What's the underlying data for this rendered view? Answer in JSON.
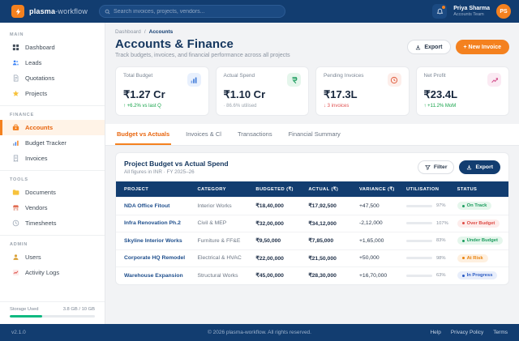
{
  "topbar": {
    "brand_bold": "plasma",
    "brand_light": "-workflow",
    "search_placeholder": "Search invoices, projects, vendors...",
    "user_name": "Priya Sharma",
    "user_role": "Accounts Team",
    "avatar_initials": "PS"
  },
  "sidebar": {
    "sections": [
      {
        "title": "MAIN",
        "items": [
          {
            "label": "Dashboard",
            "icon": "dashboard",
            "active": false
          },
          {
            "label": "Leads",
            "icon": "leads",
            "active": false
          },
          {
            "label": "Quotations",
            "icon": "quotations",
            "active": false
          },
          {
            "label": "Projects",
            "icon": "projects",
            "active": false
          }
        ]
      },
      {
        "title": "FINANCE",
        "items": [
          {
            "label": "Accounts",
            "icon": "accounts",
            "active": true
          },
          {
            "label": "Budget Tracker",
            "icon": "budget-tracker",
            "active": false
          },
          {
            "label": "Invoices",
            "icon": "invoices",
            "active": false
          }
        ]
      },
      {
        "title": "TOOLS",
        "items": [
          {
            "label": "Documents",
            "icon": "documents",
            "active": false
          },
          {
            "label": "Vendors",
            "icon": "vendors",
            "active": false
          },
          {
            "label": "Timesheets",
            "icon": "timesheets",
            "active": false
          }
        ]
      },
      {
        "title": "ADMIN",
        "items": [
          {
            "label": "Users",
            "icon": "users",
            "active": false
          },
          {
            "label": "Activity Logs",
            "icon": "activity-logs",
            "active": false
          }
        ]
      }
    ],
    "storage_label": "Storage Used",
    "storage_value": "3.8 GB / 10 GB",
    "storage_pct": 38
  },
  "breadcrumb": {
    "parent": "Dashboard",
    "separator": "/",
    "current": "Accounts"
  },
  "page": {
    "title": "Accounts & Finance",
    "subtitle": "Track budgets, invoices, and financial performance across all projects",
    "export_label": "Export",
    "new_invoice_label": "+ New Invoice"
  },
  "stats": [
    {
      "label": "Total Budget",
      "value": "₹1.27 Cr",
      "delta": "↑ +6.2% vs last Q",
      "delta_color": "green",
      "icon": "bar-chart",
      "icon_bg": "#e8f0fd",
      "icon_color": "#3b77d8"
    },
    {
      "label": "Actual Spend",
      "value": "₹1.10 Cr",
      "delta": "· 86.6% utilised",
      "delta_color": "gray",
      "icon": "currency",
      "icon_bg": "#e5f6ec",
      "icon_color": "#1d9d5f"
    },
    {
      "label": "Pending Invoices",
      "value": "₹17.3L",
      "delta": "↓ 3 invoices",
      "delta_color": "red",
      "icon": "clock",
      "icon_bg": "#fdeeea",
      "icon_color": "#e05a3a"
    },
    {
      "label": "Net Profit",
      "value": "₹23.4L",
      "delta": "↑ +11.2% MoM",
      "delta_color": "green",
      "icon": "trend-up",
      "icon_bg": "#fbeaf3",
      "icon_color": "#d4548f"
    }
  ],
  "tabs": [
    {
      "label": "Budget vs Actuals",
      "active": true
    },
    {
      "label": "Invoices & Cl",
      "active": false
    },
    {
      "label": "Transactions",
      "active": false
    },
    {
      "label": "Financial Summary",
      "active": false
    }
  ],
  "table_card": {
    "title": "Project Budget vs Actual Spend",
    "subtitle": "All figures in INR · FY 2025–26",
    "filter_label": "Filter",
    "export_label": "Export",
    "columns": [
      "PROJECT",
      "CATEGORY",
      "BUDGETED (₹)",
      "ACTUAL (₹)",
      "VARIANCE (₹)",
      "UTILISATION",
      "STATUS"
    ],
    "rows": [
      {
        "project": "NDA Office Fitout",
        "category": "Interior Works",
        "budgeted": "₹18,40,000",
        "actual": "₹17,92,500",
        "variance": "+47,500",
        "utilisation_pct": 97,
        "utilisation_label": "97%",
        "bar_color": "#f4811f",
        "status": "On Track",
        "status_type": "green"
      },
      {
        "project": "Infra Renovation Ph.2",
        "category": "Civil & MEP",
        "budgeted": "₹32,00,000",
        "actual": "₹34,12,000",
        "variance": "-2,12,000",
        "utilisation_pct": 107,
        "utilisation_label": "107%",
        "bar_color": "#dd4b45",
        "status": "Over Budget",
        "status_type": "red"
      },
      {
        "project": "Skyline Interior Works",
        "category": "Furniture & FF&E",
        "budgeted": "₹9,50,000",
        "actual": "₹7,85,000",
        "variance": "+1,65,000",
        "utilisation_pct": 83,
        "utilisation_label": "83%",
        "bar_color": "#10b981",
        "status": "Under Budget",
        "status_type": "green"
      },
      {
        "project": "Corporate HQ Remodel",
        "category": "Electrical & HVAC",
        "budgeted": "₹22,00,000",
        "actual": "₹21,50,000",
        "variance": "+50,000",
        "utilisation_pct": 98,
        "utilisation_label": "98%",
        "bar_color": "#f4811f",
        "status": "At Risk",
        "status_type": "orange"
      },
      {
        "project": "Warehouse Expansion",
        "category": "Structural Works",
        "budgeted": "₹45,00,000",
        "actual": "₹28,30,000",
        "variance": "+16,70,000",
        "utilisation_pct": 63,
        "utilisation_label": "63%",
        "bar_color": "#10b981",
        "status": "In Progress",
        "status_type": "blue"
      }
    ]
  },
  "footer": {
    "version": "v2.1.0",
    "copyright": "© 2026 plasma-workflow. All rights reserved.",
    "links": [
      "Help",
      "Privacy Policy",
      "Terms"
    ]
  }
}
